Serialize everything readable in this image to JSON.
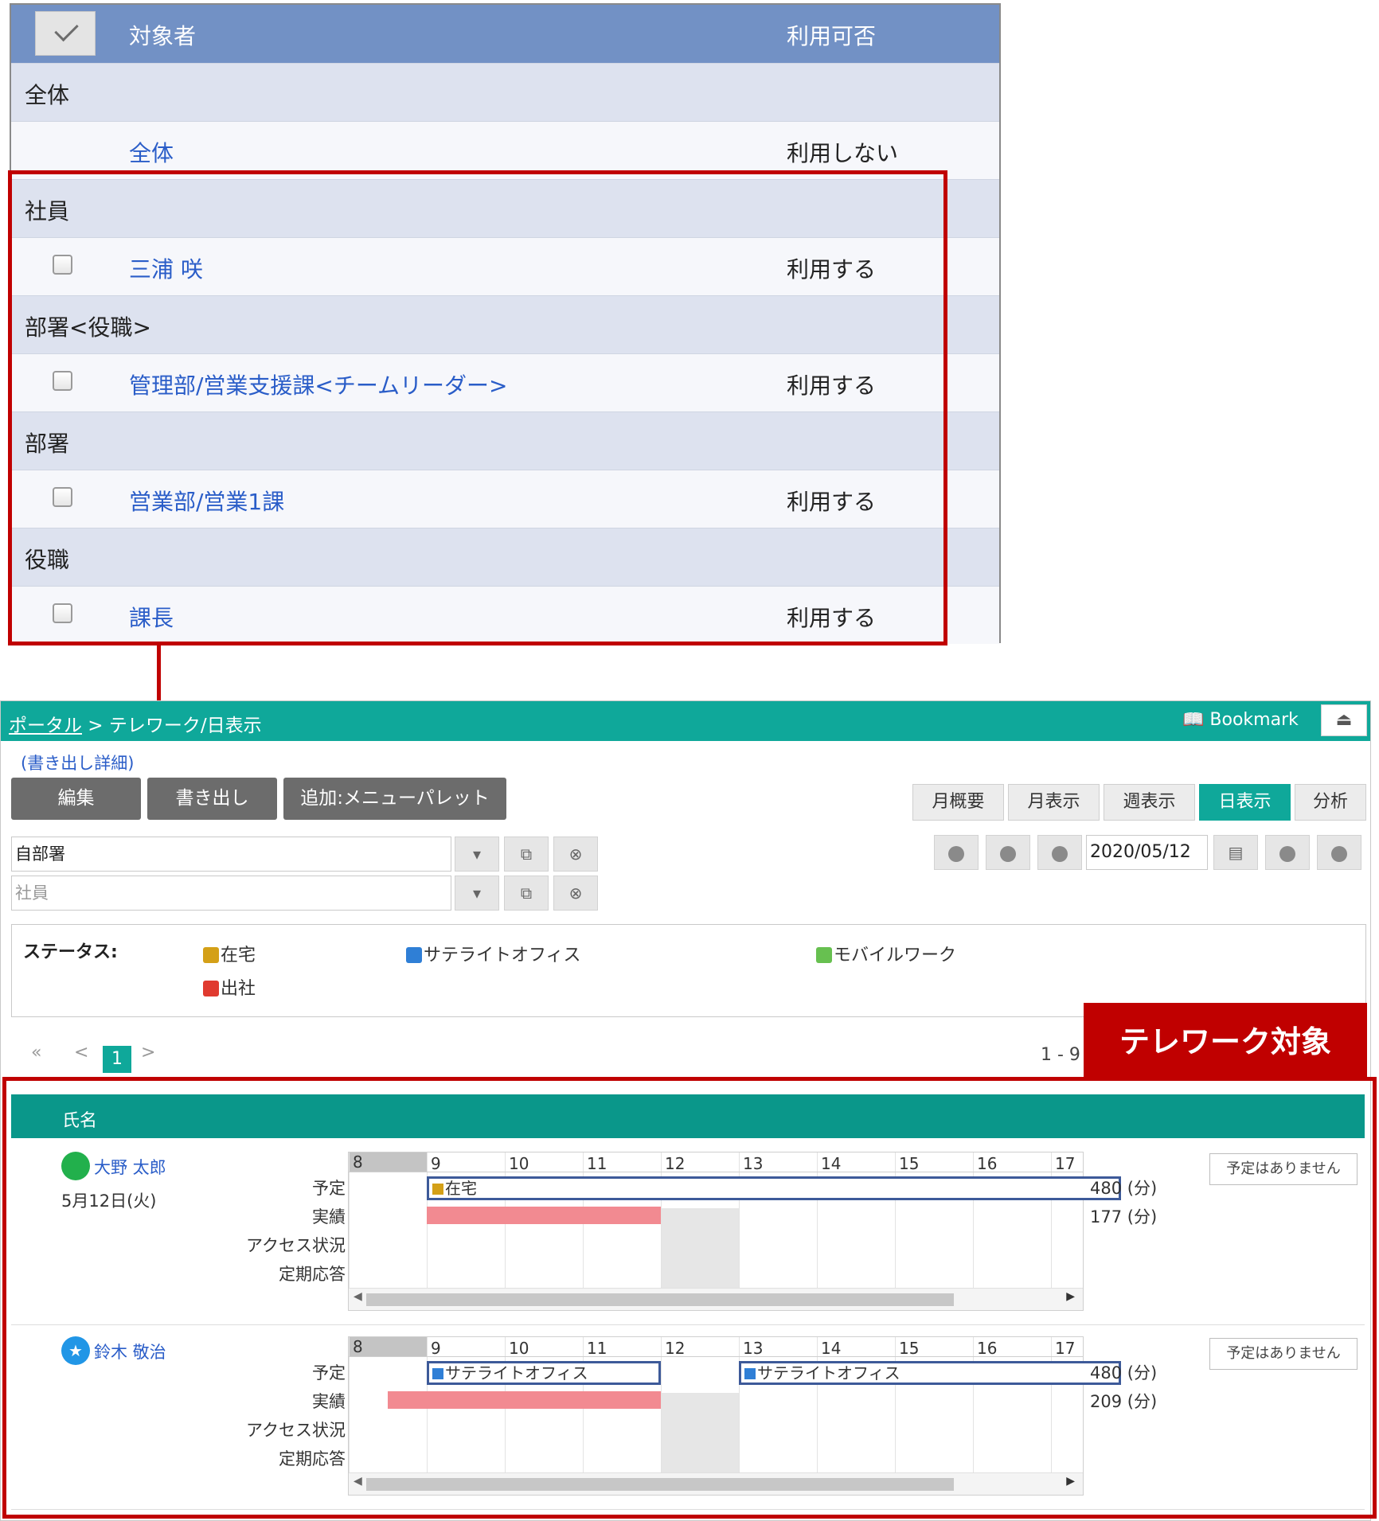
{
  "settings": {
    "header": {
      "target_label": "対象者",
      "availability_label": "利用可否"
    },
    "groups": [
      {
        "title": "全体",
        "items": [
          {
            "name": "全体",
            "value": "利用しない",
            "checkbox": false
          }
        ]
      },
      {
        "title": "社員",
        "items": [
          {
            "name": "三浦 咲",
            "value": "利用する",
            "checkbox": true
          }
        ]
      },
      {
        "title": "部署<役職>",
        "items": [
          {
            "name": "管理部/営業支援課<チームリーダー>",
            "value": "利用する",
            "checkbox": true
          }
        ]
      },
      {
        "title": "部署",
        "items": [
          {
            "name": "営業部/営業1課",
            "value": "利用する",
            "checkbox": true
          }
        ]
      },
      {
        "title": "役職",
        "items": [
          {
            "name": "課長",
            "value": "利用する",
            "checkbox": true
          }
        ]
      }
    ]
  },
  "telework": {
    "breadcrumb": {
      "portal": "ポータル",
      "sep": " > ",
      "page": "テレワーク/日表示"
    },
    "bookmark_label": "Bookmark",
    "up_icon": "eject-icon",
    "export_detail": "(書き出し詳細)",
    "buttons": {
      "edit": "編集",
      "export": "書き出し",
      "add_palette": "追加:メニューパレット"
    },
    "view_tabs": [
      "月概要",
      "月表示",
      "週表示",
      "日表示",
      "分析"
    ],
    "active_tab": "日表示",
    "dept_select": {
      "value": "自部署"
    },
    "employee_select": {
      "placeholder": "社員"
    },
    "date_value": "2020/05/12",
    "status": {
      "label": "ステータス:",
      "items": [
        {
          "label": "在宅",
          "color": "#d4a017"
        },
        {
          "label": "サテライトオフィス",
          "color": "#2f7fd6"
        },
        {
          "label": "モバイルワーク",
          "color": "#67c050"
        },
        {
          "label": "出社",
          "color": "#e03a2f"
        }
      ]
    },
    "pager": {
      "first": "«",
      "prev": "<",
      "current": "1",
      "next": ">",
      "count_text": "1 - 9"
    },
    "badge": "テレワーク対象",
    "list_header": "氏名",
    "row_labels": [
      "予定",
      "実績",
      "アクセス状況",
      "定期応答"
    ],
    "hours": [
      "8",
      "9",
      "10",
      "11",
      "12",
      "13",
      "14",
      "15",
      "16",
      "17"
    ],
    "people": [
      {
        "name": "大野 太郎",
        "date": "5月12日(火)",
        "avatar_color": "#22b04c",
        "avatar_icon": "dot",
        "plans": [
          {
            "label": "在宅",
            "color": "#d4a017",
            "start": 9,
            "end": 17.9
          }
        ],
        "actual": {
          "start": 9,
          "end": 12
        },
        "plan_minutes": "480 (分)",
        "actual_minutes": "177 (分)",
        "note": "予定はありません"
      },
      {
        "name": "鈴木 敬治",
        "date": "",
        "avatar_color": "#2196e6",
        "avatar_icon": "★",
        "plans": [
          {
            "label": "サテライトオフィス",
            "color": "#2f7fd6",
            "start": 9,
            "end": 12
          },
          {
            "label": "サテライトオフィス",
            "color": "#2f7fd6",
            "start": 13,
            "end": 17.9
          }
        ],
        "actual": {
          "start": 8.5,
          "end": 12
        },
        "plan_minutes": "480 (分)",
        "actual_minutes": "209 (分)",
        "note": "予定はありません"
      }
    ]
  }
}
